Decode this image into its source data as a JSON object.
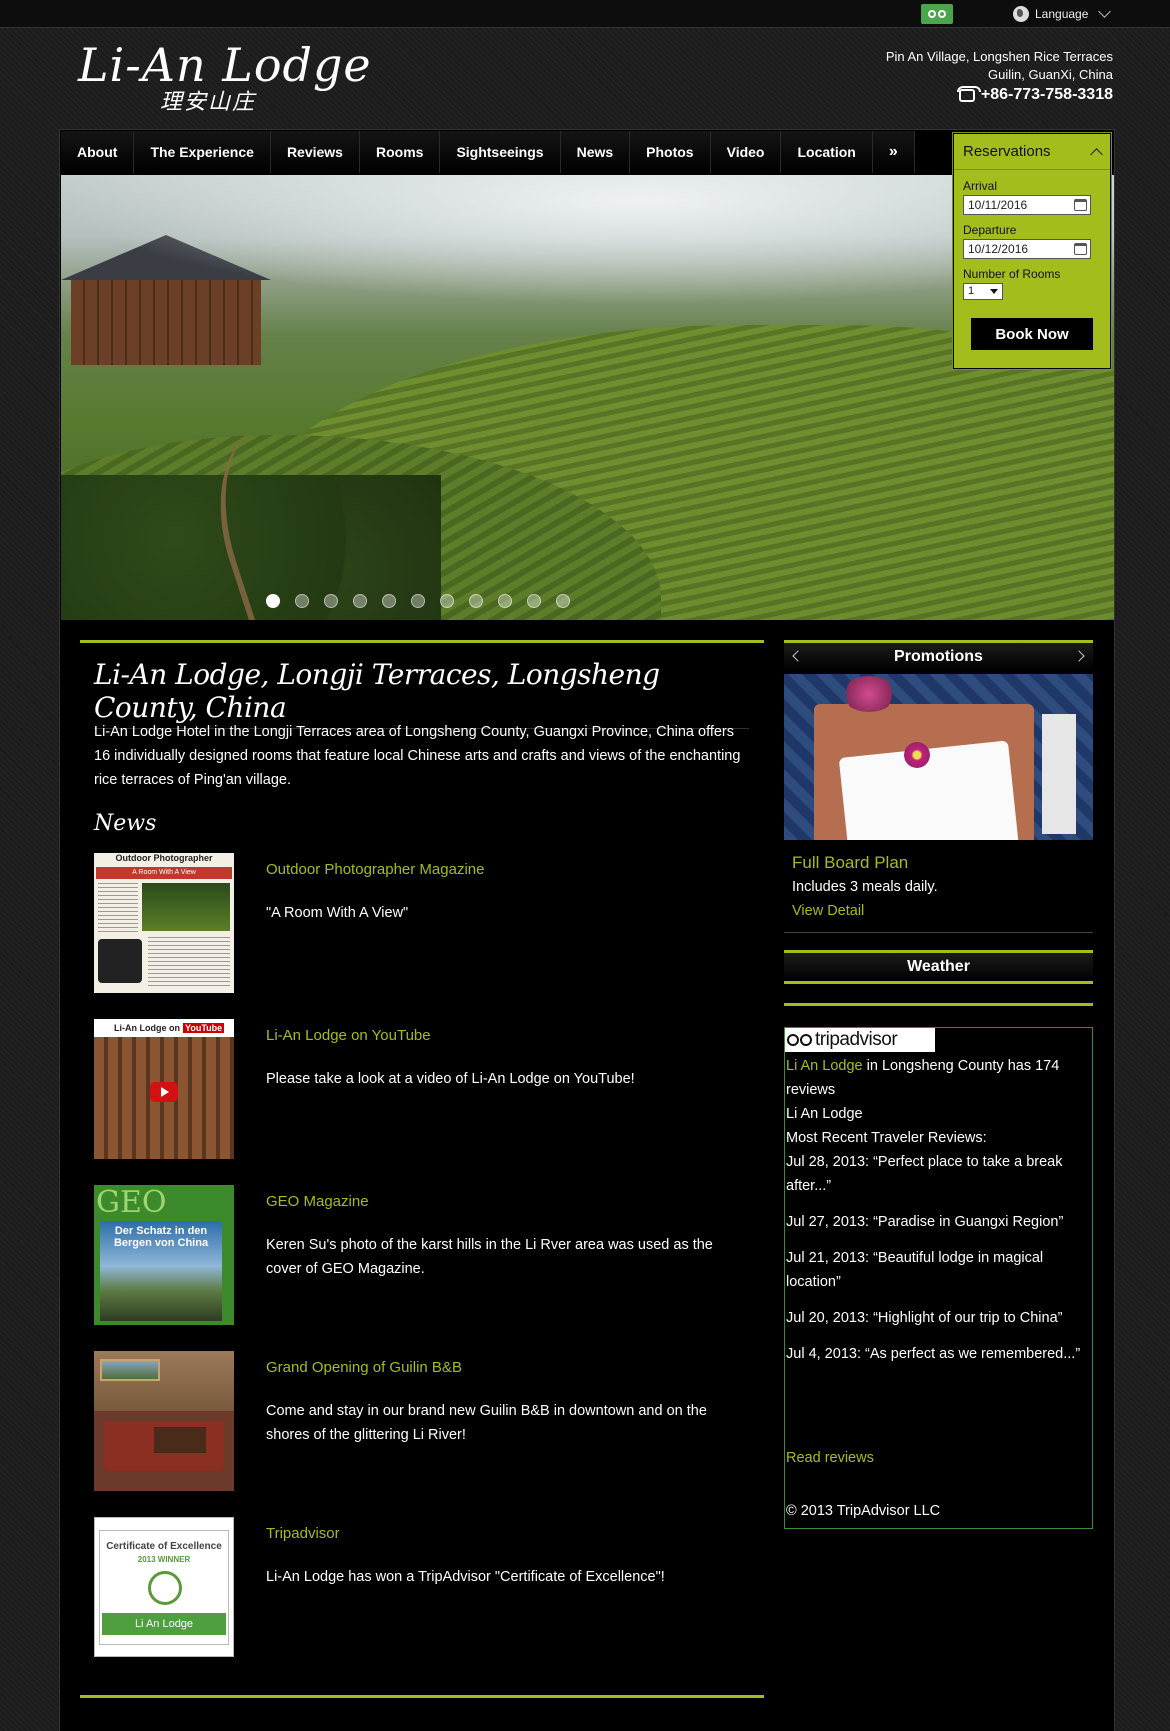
{
  "topbar": {
    "tripadvisor_icon": "tripadvisor-owl-icon",
    "language_label": "Language"
  },
  "header": {
    "logo_text": "Li-An Lodge",
    "logo_chinese": "理安山庄",
    "address_line1": "Pin An Village, Longshen Rice Terraces",
    "address_line2": "Guilin, GuanXi, China",
    "phone": "+86-773-758-3318"
  },
  "nav": {
    "items": [
      "About",
      "The Experience",
      "Reviews",
      "Rooms",
      "Sightseeings",
      "News",
      "Photos",
      "Video",
      "Location",
      "»"
    ]
  },
  "slideshow": {
    "slide_count": 11,
    "active_index": 0
  },
  "reservations": {
    "title": "Reservations",
    "arrival_label": "Arrival",
    "arrival_value": "10/11/2016",
    "departure_label": "Departure",
    "departure_value": "10/12/2016",
    "rooms_label": "Number of Rooms",
    "rooms_value": "1",
    "book_button": "Book Now"
  },
  "main": {
    "title": "Li-An Lodge, Longji Terraces, Longsheng County, China",
    "intro": "Li-An Lodge Hotel in the Longji Terraces area of Longsheng County, Guangxi Province, China offers 16 individually designed rooms that feature local Chinese arts and crafts and views of the enchanting rice terraces of Ping'an village.",
    "news_heading": "News",
    "news": [
      {
        "title": "Outdoor Photographer Magazine",
        "desc": "\"A Room With A View\""
      },
      {
        "title": "Li-An Lodge on YouTube",
        "desc": "Please take a look at a video of Li-An Lodge on YouTube!"
      },
      {
        "title": "GEO Magazine",
        "desc": "Keren Su's photo of the karst hills in the Li Rver area was used as the cover of GEO Magazine."
      },
      {
        "title": "Grand Opening of Guilin B&B",
        "desc": "Come and stay in our brand new Guilin B&B in downtown and on the shores of the glittering Li River!"
      },
      {
        "title": "Tripadvisor",
        "desc": "Li-An Lodge has won a TripAdvisor \"Certificate of Excellence\"!"
      }
    ],
    "thumb_texts": {
      "outdoor_header": "Outdoor Photographer",
      "outdoor_banner": "A Room With A View",
      "youtube_bar": "Li-An Lodge on",
      "youtube_badge": "YouTube",
      "geo_logo": "GEO",
      "geo_cover": "Der Schatz in den Bergen von China",
      "cert_title": "Certificate of Excellence",
      "cert_year": "2013 WINNER",
      "cert_name": "Li An Lodge"
    }
  },
  "promotions": {
    "heading": "Promotions",
    "item_title": "Full Board Plan",
    "item_desc": "Includes 3 meals daily.",
    "item_link": "View Detail"
  },
  "weather": {
    "heading": "Weather"
  },
  "tripadvisor": {
    "logo_text": "tripadvisor",
    "link_name": "Li An Lodge",
    "summary_rest": " in Longsheng County has 174 reviews",
    "name_line": "Li An Lodge",
    "recent_label": "Most Recent Traveler Reviews:",
    "reviews": [
      "Jul 28, 2013: “Perfect place to take a break after...”",
      "Jul 27, 2013: “Paradise in Guangxi Region”",
      "Jul 21, 2013: “Beautiful lodge in magical location”",
      "Jul 20, 2013: “Highlight of our trip to China”",
      "Jul 4, 2013: “As perfect as we remembered...”"
    ],
    "read_reviews": "Read reviews",
    "copyright": "© 2013 TripAdvisor LLC"
  },
  "colors": {
    "accent_green": "#a3bd1c",
    "background": "#000000"
  }
}
